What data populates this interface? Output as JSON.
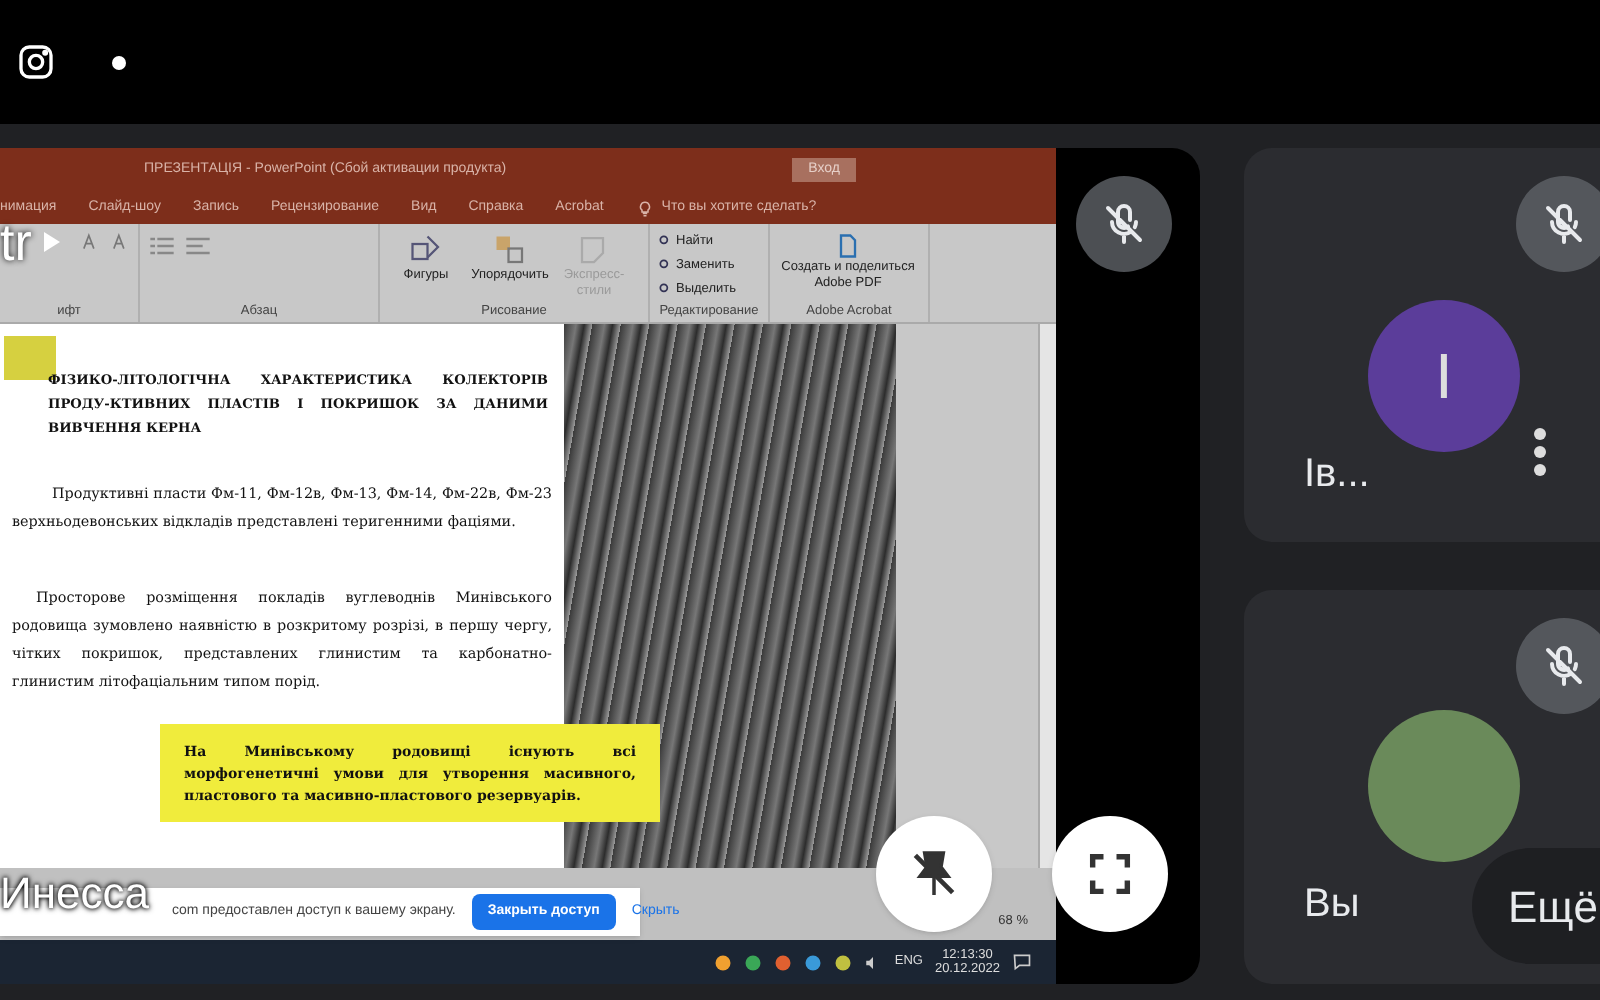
{
  "presenter_tile": {
    "name": "Инесса",
    "overlay_text": "tr",
    "muted": true,
    "shared_window": {
      "title": "ПРЕЗЕНТАЦІЯ  -  PowerPoint (Сбой активации продукта)",
      "sign_in": "Вход",
      "menu_tabs": [
        "нимация",
        "Слайд-шоу",
        "Запись",
        "Рецензирование",
        "Вид",
        "Справка",
        "Acrobat"
      ],
      "tell_me": "Что вы хотите сделать?",
      "ribbon_buttons": [
        {
          "kind": "big",
          "label": "Фигуры",
          "disabled": false
        },
        {
          "kind": "big",
          "label": "Упорядочить",
          "disabled": false
        },
        {
          "kind": "big",
          "label": "Экспресс-стили",
          "disabled": true
        },
        {
          "kind": "small",
          "label": "Найти",
          "disabled": false
        },
        {
          "kind": "small",
          "label": "Заменить",
          "disabled": false
        },
        {
          "kind": "small",
          "label": "Выделить",
          "disabled": false
        },
        {
          "kind": "pdf",
          "label": "Создать и поделиться Adobe PDF",
          "disabled": false
        }
      ],
      "ribbon_groups": [
        "ифт",
        "Абзац",
        "Рисование",
        "Редактирование",
        "Adobe Acrobat"
      ],
      "slide": {
        "title": "ФІЗИКО-ЛІТОЛОГІЧНА ХАРАКТЕРИСТИКА КОЛЕКТОРІВ ПРОДУ-КТИВНИХ ПЛАСТІВ І ПОКРИШОК ЗА ДАНИМИ ВИВЧЕННЯ КЕРНА",
        "paragraphs": [
          "Продуктивні пласти Фм-11, Фм-12в, Фм-13, Фм-14, Фм-22в, Фм-23 верхньодевонських відкладів представлені теригенними фаціями.",
          "Просторове розміщення покладів вуглеводнів Минівського родовища зумовлено наявністю в розкритому розрізі, в першу чергу, чітких покришок, представлених глинистим та карбонатно-глинистим літофаціальним типом порід."
        ],
        "callout": "На Минівському родовищі існують всі морфогенетичні умови для утворення масивного, пластового та масивно-пластового резервуарів."
      },
      "share_banner": {
        "message": "com предоставлен доступ к вашему экрану.",
        "stop_button": "Закрыть доступ",
        "hide_link": "Скрыть"
      },
      "zoom": "68 %",
      "taskbar": {
        "language": "ENG",
        "time": "12:13:30",
        "date": "20.12.2022"
      }
    }
  },
  "participants": [
    {
      "name": "Ів...",
      "initial": "I",
      "kind": "letter",
      "muted": true
    },
    {
      "name": "Вы",
      "kind": "photo",
      "muted": true
    }
  ],
  "more_button": "Ещё"
}
